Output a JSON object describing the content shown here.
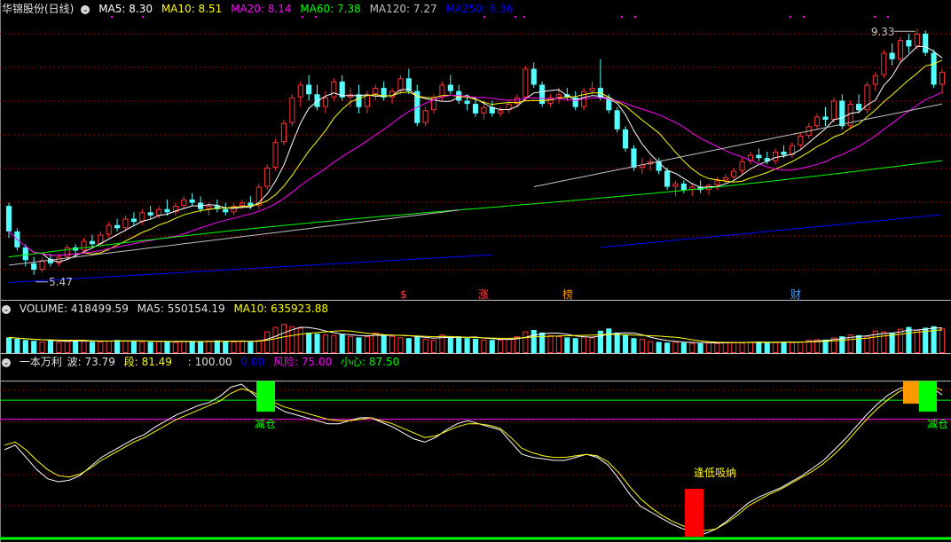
{
  "header": {
    "stock_title": "华锦股份(日线)",
    "ma_items": [
      {
        "label": "MA5: 8.30",
        "color": "#ffffff"
      },
      {
        "label": "MA10: 8.51",
        "color": "#ffff00"
      },
      {
        "label": "MA20: 8.14",
        "color": "#ff00ff"
      },
      {
        "label": "MA60: 7.38",
        "color": "#00ff00"
      },
      {
        "label": "MA120: 7.27",
        "color": "#c0c0c0"
      },
      {
        "label": "MA250: 6.36",
        "color": "#0000ff"
      }
    ]
  },
  "volume_header": {
    "label": "VOLUME: 418499.59",
    "ma5": "MA5: 550154.19",
    "ma10": "MA10: 635923.88"
  },
  "indicator_header": {
    "name": "一本万利",
    "bo": "波: 73.79",
    "duan": "段: 81.49",
    "level_100": ": 100.00",
    "level_0": "0.00",
    "fengxian": "风险: 75.00",
    "xiaoxin": "小心: 87.50"
  },
  "price_annotations": {
    "high": "9.33",
    "low": "5.47"
  },
  "event_markers": [
    {
      "label": "$",
      "color": "#ff4040"
    },
    {
      "label": "涨",
      "color": "#ff4040"
    },
    {
      "label": "榜",
      "color": "#ff9900"
    },
    {
      "label": "财",
      "color": "#40a0ff"
    }
  ],
  "signal_labels": {
    "sell1": "减仓",
    "sell2": "减仓",
    "buy": "逢低吸纳"
  },
  "colors": {
    "up": "#ff3232",
    "down": "#54ffff",
    "ma5": "#ffffff",
    "ma10": "#ffff00",
    "ma20": "#ff00ff",
    "ma60": "#00ff00",
    "ma120": "#c0c0c0",
    "ma250": "#0000ff",
    "grid": "#aa0000",
    "risk_line": "#00ff00",
    "caution_line": "#ff00ff",
    "top_line": "#c0c0c0"
  },
  "chart_data": [
    {
      "type": "candlestick",
      "title": "华锦股份(日线)",
      "ylim": [
        5.3,
        9.5
      ],
      "marked_high": 9.33,
      "marked_low": 5.47,
      "candles": [
        {
          "o": 6.55,
          "h": 6.6,
          "l": 6.05,
          "c": 6.15
        },
        {
          "o": 6.15,
          "h": 6.2,
          "l": 5.85,
          "c": 5.9
        },
        {
          "o": 5.9,
          "h": 5.95,
          "l": 5.6,
          "c": 5.7
        },
        {
          "o": 5.65,
          "h": 5.75,
          "l": 5.47,
          "c": 5.55
        },
        {
          "o": 5.55,
          "h": 5.75,
          "l": 5.5,
          "c": 5.7
        },
        {
          "o": 5.72,
          "h": 5.8,
          "l": 5.6,
          "c": 5.65
        },
        {
          "o": 5.65,
          "h": 5.8,
          "l": 5.6,
          "c": 5.75
        },
        {
          "o": 5.75,
          "h": 5.95,
          "l": 5.7,
          "c": 5.9
        },
        {
          "o": 5.9,
          "h": 5.95,
          "l": 5.75,
          "c": 5.85
        },
        {
          "o": 5.85,
          "h": 6.05,
          "l": 5.8,
          "c": 6.0
        },
        {
          "o": 6.0,
          "h": 6.1,
          "l": 5.9,
          "c": 5.95
        },
        {
          "o": 5.95,
          "h": 6.15,
          "l": 5.9,
          "c": 6.1
        },
        {
          "o": 6.1,
          "h": 6.3,
          "l": 6.05,
          "c": 6.25
        },
        {
          "o": 6.25,
          "h": 6.35,
          "l": 6.15,
          "c": 6.2
        },
        {
          "o": 6.2,
          "h": 6.4,
          "l": 6.15,
          "c": 6.35
        },
        {
          "o": 6.35,
          "h": 6.45,
          "l": 6.25,
          "c": 6.3
        },
        {
          "o": 6.3,
          "h": 6.5,
          "l": 6.25,
          "c": 6.45
        },
        {
          "o": 6.45,
          "h": 6.55,
          "l": 6.35,
          "c": 6.4
        },
        {
          "o": 6.4,
          "h": 6.55,
          "l": 6.35,
          "c": 6.5
        },
        {
          "o": 6.5,
          "h": 6.65,
          "l": 6.4,
          "c": 6.45
        },
        {
          "o": 6.45,
          "h": 6.6,
          "l": 6.4,
          "c": 6.55
        },
        {
          "o": 6.55,
          "h": 6.7,
          "l": 6.5,
          "c": 6.65
        },
        {
          "o": 6.65,
          "h": 6.75,
          "l": 6.55,
          "c": 6.6
        },
        {
          "o": 6.6,
          "h": 6.7,
          "l": 6.45,
          "c": 6.5
        },
        {
          "o": 6.5,
          "h": 6.6,
          "l": 6.4,
          "c": 6.55
        },
        {
          "o": 6.55,
          "h": 6.65,
          "l": 6.45,
          "c": 6.5
        },
        {
          "o": 6.5,
          "h": 6.6,
          "l": 6.4,
          "c": 6.45
        },
        {
          "o": 6.45,
          "h": 6.6,
          "l": 6.4,
          "c": 6.55
        },
        {
          "o": 6.55,
          "h": 6.65,
          "l": 6.5,
          "c": 6.6
        },
        {
          "o": 6.6,
          "h": 6.7,
          "l": 6.5,
          "c": 6.55
        },
        {
          "o": 6.55,
          "h": 6.9,
          "l": 6.5,
          "c": 6.85
        },
        {
          "o": 6.85,
          "h": 7.2,
          "l": 6.8,
          "c": 7.15
        },
        {
          "o": 7.15,
          "h": 7.6,
          "l": 7.1,
          "c": 7.55
        },
        {
          "o": 7.55,
          "h": 7.9,
          "l": 7.5,
          "c": 7.85
        },
        {
          "o": 7.85,
          "h": 8.3,
          "l": 7.8,
          "c": 8.25
        },
        {
          "o": 8.25,
          "h": 8.5,
          "l": 8.1,
          "c": 8.45
        },
        {
          "o": 8.45,
          "h": 8.6,
          "l": 8.2,
          "c": 8.3
        },
        {
          "o": 8.3,
          "h": 8.45,
          "l": 8.05,
          "c": 8.1
        },
        {
          "o": 8.1,
          "h": 8.35,
          "l": 8.0,
          "c": 8.25
        },
        {
          "o": 8.25,
          "h": 8.55,
          "l": 8.2,
          "c": 8.5
        },
        {
          "o": 8.5,
          "h": 8.6,
          "l": 8.2,
          "c": 8.25
        },
        {
          "o": 8.25,
          "h": 8.4,
          "l": 8.1,
          "c": 8.3
        },
        {
          "o": 8.3,
          "h": 8.45,
          "l": 8.0,
          "c": 8.1
        },
        {
          "o": 8.1,
          "h": 8.35,
          "l": 8.0,
          "c": 8.3
        },
        {
          "o": 8.3,
          "h": 8.45,
          "l": 8.2,
          "c": 8.4
        },
        {
          "o": 8.4,
          "h": 8.5,
          "l": 8.2,
          "c": 8.25
        },
        {
          "o": 8.25,
          "h": 8.4,
          "l": 8.15,
          "c": 8.35
        },
        {
          "o": 8.35,
          "h": 8.6,
          "l": 8.3,
          "c": 8.55
        },
        {
          "o": 8.55,
          "h": 8.7,
          "l": 8.3,
          "c": 8.35
        },
        {
          "o": 8.35,
          "h": 8.45,
          "l": 7.8,
          "c": 7.85
        },
        {
          "o": 7.85,
          "h": 8.1,
          "l": 7.8,
          "c": 8.05
        },
        {
          "o": 8.05,
          "h": 8.3,
          "l": 8.0,
          "c": 8.25
        },
        {
          "o": 8.25,
          "h": 8.5,
          "l": 8.2,
          "c": 8.45
        },
        {
          "o": 8.45,
          "h": 8.6,
          "l": 8.3,
          "c": 8.35
        },
        {
          "o": 8.35,
          "h": 8.45,
          "l": 8.15,
          "c": 8.2
        },
        {
          "o": 8.2,
          "h": 8.3,
          "l": 8.05,
          "c": 8.15
        },
        {
          "o": 8.15,
          "h": 8.25,
          "l": 7.95,
          "c": 8.0
        },
        {
          "o": 8.0,
          "h": 8.2,
          "l": 7.9,
          "c": 8.1
        },
        {
          "o": 8.1,
          "h": 8.2,
          "l": 7.95,
          "c": 8.0
        },
        {
          "o": 8.0,
          "h": 8.1,
          "l": 7.95,
          "c": 8.05
        },
        {
          "o": 8.05,
          "h": 8.2,
          "l": 8.0,
          "c": 8.15
        },
        {
          "o": 8.15,
          "h": 8.3,
          "l": 8.1,
          "c": 8.25
        },
        {
          "o": 8.25,
          "h": 8.75,
          "l": 8.2,
          "c": 8.7
        },
        {
          "o": 8.7,
          "h": 8.8,
          "l": 8.4,
          "c": 8.45
        },
        {
          "o": 8.45,
          "h": 8.5,
          "l": 8.1,
          "c": 8.15
        },
        {
          "o": 8.15,
          "h": 8.3,
          "l": 8.1,
          "c": 8.25
        },
        {
          "o": 8.25,
          "h": 8.4,
          "l": 8.15,
          "c": 8.3
        },
        {
          "o": 8.3,
          "h": 8.4,
          "l": 8.2,
          "c": 8.25
        },
        {
          "o": 8.25,
          "h": 8.35,
          "l": 8.05,
          "c": 8.1
        },
        {
          "o": 8.1,
          "h": 8.4,
          "l": 8.05,
          "c": 8.35
        },
        {
          "o": 8.35,
          "h": 8.5,
          "l": 8.3,
          "c": 8.4
        },
        {
          "o": 8.4,
          "h": 8.85,
          "l": 8.2,
          "c": 8.25
        },
        {
          "o": 8.25,
          "h": 8.3,
          "l": 8.0,
          "c": 8.05
        },
        {
          "o": 8.05,
          "h": 8.1,
          "l": 7.7,
          "c": 7.75
        },
        {
          "o": 7.75,
          "h": 7.8,
          "l": 7.4,
          "c": 7.45
        },
        {
          "o": 7.45,
          "h": 7.5,
          "l": 7.1,
          "c": 7.15
        },
        {
          "o": 7.15,
          "h": 7.3,
          "l": 7.05,
          "c": 7.2
        },
        {
          "o": 7.2,
          "h": 7.3,
          "l": 7.1,
          "c": 7.25
        },
        {
          "o": 7.25,
          "h": 7.3,
          "l": 7.05,
          "c": 7.1
        },
        {
          "o": 7.1,
          "h": 7.15,
          "l": 6.8,
          "c": 6.85
        },
        {
          "o": 6.85,
          "h": 6.95,
          "l": 6.7,
          "c": 6.9
        },
        {
          "o": 6.9,
          "h": 6.95,
          "l": 6.75,
          "c": 6.8
        },
        {
          "o": 6.8,
          "h": 6.9,
          "l": 6.7,
          "c": 6.85
        },
        {
          "o": 6.85,
          "h": 6.95,
          "l": 6.75,
          "c": 6.8
        },
        {
          "o": 6.8,
          "h": 6.9,
          "l": 6.72,
          "c": 6.88
        },
        {
          "o": 6.88,
          "h": 7.0,
          "l": 6.8,
          "c": 6.95
        },
        {
          "o": 6.95,
          "h": 7.05,
          "l": 6.9,
          "c": 7.0
        },
        {
          "o": 7.0,
          "h": 7.15,
          "l": 6.95,
          "c": 7.1
        },
        {
          "o": 7.1,
          "h": 7.3,
          "l": 7.05,
          "c": 7.25
        },
        {
          "o": 7.25,
          "h": 7.4,
          "l": 7.2,
          "c": 7.35
        },
        {
          "o": 7.35,
          "h": 7.45,
          "l": 7.25,
          "c": 7.3
        },
        {
          "o": 7.3,
          "h": 7.4,
          "l": 7.2,
          "c": 7.25
        },
        {
          "o": 7.25,
          "h": 7.45,
          "l": 7.2,
          "c": 7.4
        },
        {
          "o": 7.4,
          "h": 7.5,
          "l": 7.3,
          "c": 7.35
        },
        {
          "o": 7.35,
          "h": 7.55,
          "l": 7.3,
          "c": 7.5
        },
        {
          "o": 7.5,
          "h": 7.7,
          "l": 7.45,
          "c": 7.65
        },
        {
          "o": 7.65,
          "h": 7.85,
          "l": 7.6,
          "c": 7.8
        },
        {
          "o": 7.8,
          "h": 8.0,
          "l": 7.75,
          "c": 7.95
        },
        {
          "o": 7.95,
          "h": 8.1,
          "l": 7.8,
          "c": 7.9
        },
        {
          "o": 7.9,
          "h": 8.25,
          "l": 7.85,
          "c": 8.2
        },
        {
          "o": 8.2,
          "h": 8.3,
          "l": 7.75,
          "c": 7.8
        },
        {
          "o": 7.8,
          "h": 8.2,
          "l": 7.75,
          "c": 8.15
        },
        {
          "o": 8.15,
          "h": 8.3,
          "l": 8.0,
          "c": 8.05
        },
        {
          "o": 8.05,
          "h": 8.5,
          "l": 8.0,
          "c": 8.45
        },
        {
          "o": 8.45,
          "h": 8.65,
          "l": 8.35,
          "c": 8.6
        },
        {
          "o": 8.6,
          "h": 9.0,
          "l": 8.55,
          "c": 8.95
        },
        {
          "o": 8.95,
          "h": 9.1,
          "l": 8.75,
          "c": 8.85
        },
        {
          "o": 8.85,
          "h": 9.2,
          "l": 8.8,
          "c": 9.15
        },
        {
          "o": 9.15,
          "h": 9.25,
          "l": 8.95,
          "c": 9.05
        },
        {
          "o": 9.05,
          "h": 9.33,
          "l": 9.0,
          "c": 9.25
        },
        {
          "o": 9.25,
          "h": 9.3,
          "l": 8.9,
          "c": 8.95
        },
        {
          "o": 8.95,
          "h": 9.0,
          "l": 8.4,
          "c": 8.45
        },
        {
          "o": 8.45,
          "h": 8.7,
          "l": 8.3,
          "c": 8.65
        }
      ]
    },
    {
      "type": "bar",
      "title": "VOLUME",
      "volume_values": [
        0.42,
        0.38,
        0.35,
        0.33,
        0.31,
        0.34,
        0.3,
        0.32,
        0.35,
        0.33,
        0.3,
        0.31,
        0.33,
        0.35,
        0.33,
        0.32,
        0.3,
        0.3,
        0.32,
        0.31,
        0.3,
        0.32,
        0.31,
        0.3,
        0.33,
        0.34,
        0.32,
        0.31,
        0.32,
        0.3,
        0.35,
        0.58,
        0.7,
        0.78,
        0.72,
        0.68,
        0.55,
        0.52,
        0.5,
        0.48,
        0.5,
        0.46,
        0.42,
        0.45,
        0.55,
        0.5,
        0.46,
        0.42,
        0.4,
        0.44,
        0.38,
        0.35,
        0.5,
        0.42,
        0.45,
        0.4,
        0.38,
        0.36,
        0.35,
        0.36,
        0.38,
        0.45,
        0.58,
        0.62,
        0.55,
        0.48,
        0.45,
        0.42,
        0.4,
        0.44,
        0.42,
        0.6,
        0.66,
        0.55,
        0.48,
        0.4,
        0.38,
        0.32,
        0.3,
        0.28,
        0.3,
        0.28,
        0.27,
        0.26,
        0.28,
        0.27,
        0.29,
        0.3,
        0.28,
        0.3,
        0.31,
        0.28,
        0.29,
        0.3,
        0.29,
        0.31,
        0.35,
        0.37,
        0.36,
        0.42,
        0.45,
        0.5,
        0.48,
        0.46,
        0.6,
        0.58,
        0.55,
        0.65,
        0.7,
        0.62,
        0.68,
        0.72,
        0.66,
        0.7,
        0.62,
        0.55,
        0.58,
        0.6
      ],
      "ma5_label": "MA5: 550154.19",
      "ma10_label": "MA10: 635923.88"
    },
    {
      "type": "line",
      "title": "一本万利",
      "ylim": [
        -2,
        105
      ],
      "reference_levels": [
        100,
        87.5,
        75,
        0
      ],
      "bo_series": [
        55,
        58,
        50,
        42,
        36,
        34,
        35,
        38,
        44,
        50,
        54,
        58,
        62,
        65,
        70,
        74,
        78,
        81,
        84,
        86,
        90,
        96,
        98,
        92,
        86,
        84,
        80,
        78,
        76,
        74,
        72,
        72,
        74,
        76,
        76,
        73,
        70,
        66,
        62,
        60,
        63,
        68,
        72,
        74,
        72,
        70,
        68,
        60,
        52,
        50,
        49,
        48,
        48,
        50,
        52,
        50,
        45,
        36,
        26,
        18,
        14,
        10,
        6,
        3,
        1,
        0,
        3,
        8,
        14,
        20,
        24,
        27,
        30,
        34,
        38,
        43,
        48,
        55,
        62,
        70,
        78,
        85,
        91,
        95,
        97,
        98,
        96,
        91
      ],
      "duan_series": [
        58,
        60,
        55,
        48,
        42,
        38,
        37,
        39,
        43,
        48,
        52,
        56,
        60,
        63,
        67,
        71,
        75,
        78,
        81,
        84,
        87,
        92,
        95,
        93,
        89,
        86,
        83,
        81,
        79,
        77,
        75,
        74,
        74,
        75,
        76,
        74,
        72,
        69,
        66,
        63,
        64,
        67,
        70,
        72,
        72,
        71,
        69,
        63,
        56,
        53,
        51,
        50,
        50,
        51,
        52,
        51,
        47,
        40,
        31,
        23,
        17,
        12,
        8,
        5,
        3,
        2,
        3,
        7,
        12,
        18,
        22,
        26,
        29,
        33,
        37,
        41,
        46,
        52,
        59,
        67,
        75,
        82,
        88,
        93,
        96,
        97,
        97,
        94
      ],
      "signals": [
        {
          "type": "sell",
          "label": "减仓"
        },
        {
          "type": "buy",
          "label": "逢低吸纳"
        },
        {
          "type": "sell",
          "label": "减仓"
        }
      ]
    }
  ]
}
